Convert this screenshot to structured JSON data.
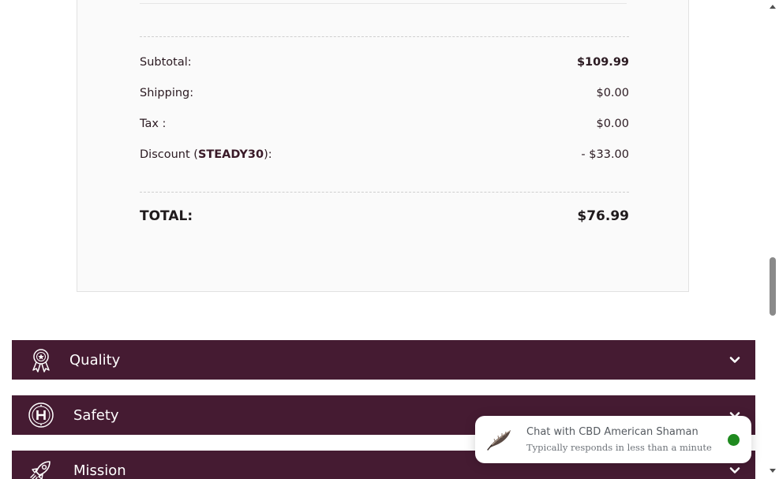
{
  "order_summary": {
    "subtotal_label": "Subtotal:",
    "subtotal_value": "$109.99",
    "shipping_label": "Shipping:",
    "shipping_value": "$0.00",
    "tax_label": "Tax :",
    "tax_value": "$0.00",
    "discount_label_prefix": "Discount (",
    "discount_code": "STEADY30",
    "discount_label_suffix": "):",
    "discount_value": "- $33.00",
    "total_label": "TOTAL:",
    "total_value": "$76.99"
  },
  "accordion": {
    "items": [
      {
        "label": "Quality",
        "icon": "award-ribbon-icon"
      },
      {
        "label": "Safety",
        "icon": "hemp-seal-icon"
      },
      {
        "label": "Mission",
        "icon": "rocket-icon"
      }
    ],
    "bar_color": "#451b32"
  },
  "chat": {
    "title": "Chat with CBD American Shaman",
    "subtitle": "Typically responds in less than a minute",
    "avatar_icon": "feather-icon",
    "status_color": "#1f8a1f"
  }
}
